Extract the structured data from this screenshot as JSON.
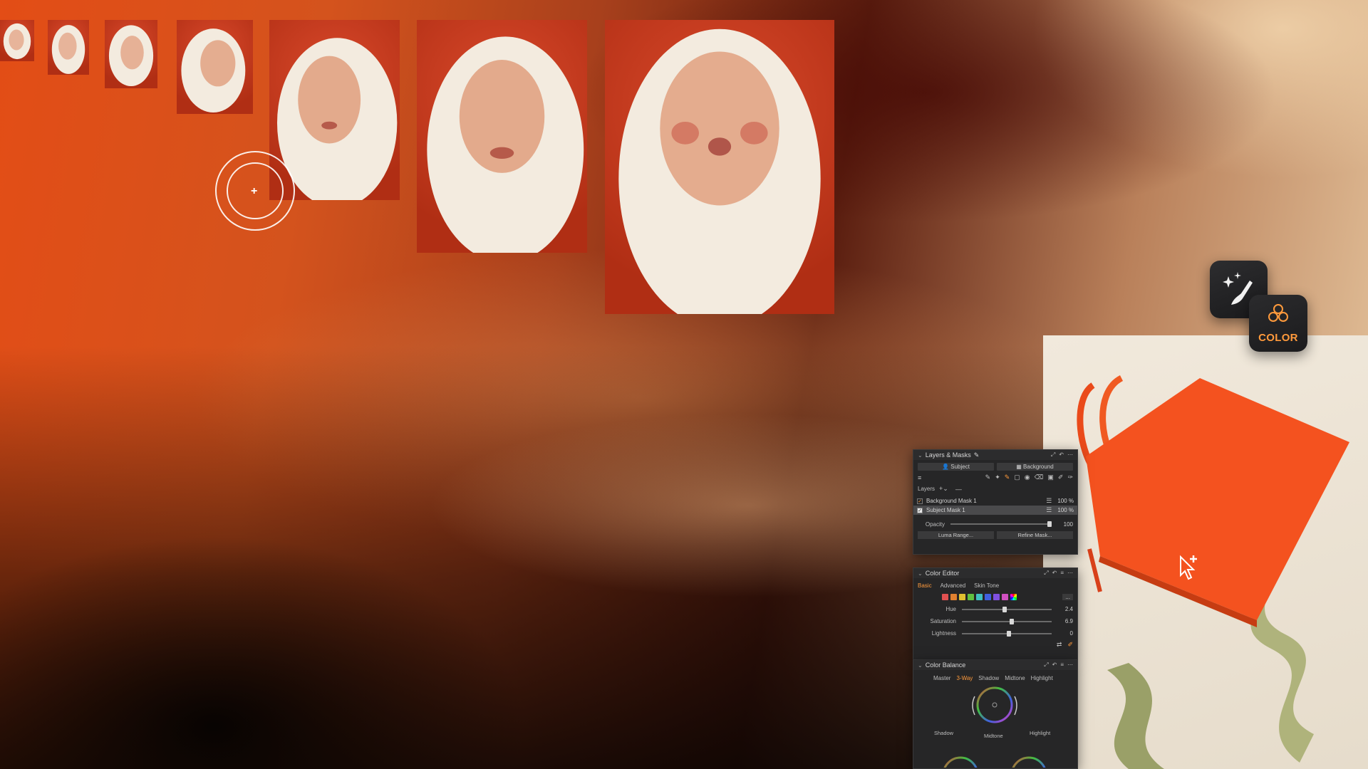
{
  "layers_masks": {
    "title": "Layers & Masks",
    "subject_button": "Subject",
    "background_button": "Background",
    "layers_label": "Layers",
    "layers": [
      {
        "name": "Background Mask 1",
        "opacity": "100 %",
        "checked": true,
        "selected": false
      },
      {
        "name": "Subject Mask 1",
        "opacity": "100 %",
        "checked": true,
        "selected": true
      }
    ],
    "opacity_label": "Opacity",
    "opacity_value": "100",
    "opacity_level": 1.0,
    "luma_range_button": "Luma Range...",
    "refine_mask_button": "Refine Mask..."
  },
  "color_editor": {
    "title": "Color Editor",
    "tabs": [
      "Basic",
      "Advanced",
      "Skin Tone"
    ],
    "active_tab": "Basic",
    "swatches": [
      "#e05050",
      "#e08030",
      "#e0c030",
      "#60c040",
      "#40c0c0",
      "#4060e0",
      "#8050e0",
      "#d050c0"
    ],
    "more_button": "...",
    "sliders": [
      {
        "label": "Hue",
        "value": "2.4",
        "level": 0.45
      },
      {
        "label": "Saturation",
        "value": "6.9",
        "level": 0.53
      },
      {
        "label": "Lightness",
        "value": "0",
        "level": 0.5
      }
    ]
  },
  "color_balance": {
    "title": "Color Balance",
    "tabs": [
      "Master",
      "3-Way",
      "Shadow",
      "Midtone",
      "Highlight"
    ],
    "active_tab": "3-Way",
    "wheel_labels": [
      "Shadow",
      "Midtone",
      "Highlight"
    ]
  },
  "app_icons": {
    "retouch_icon": "magic-brush",
    "color_label": "COLOR",
    "accent": "#ff9a3c"
  },
  "cursor": {
    "target_icon": "crosshair-circle",
    "pointer_icon": "add-cursor"
  }
}
